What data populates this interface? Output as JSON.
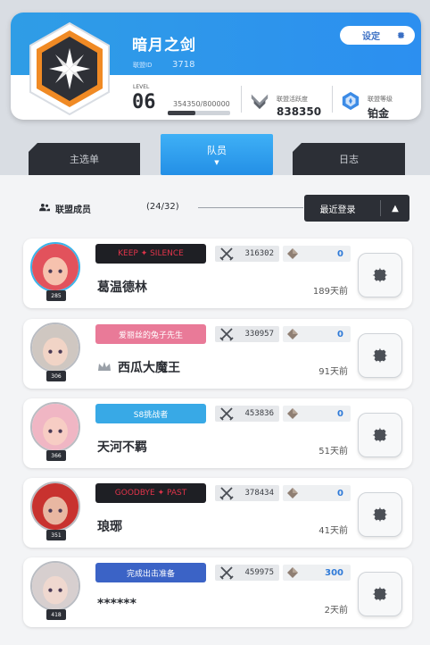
{
  "header": {
    "alliance_name": "暗月之剑",
    "alliance_id_label": "联盟ID",
    "alliance_id": "3718",
    "settings_label": "设定",
    "level_label": "LEVEL",
    "level": "06",
    "exp_text": "354350/800000",
    "exp_progress": 0.443,
    "activity_label": "联盟活跃度",
    "activity_value": "838350",
    "rank_label": "联盟等级",
    "rank_value": "铂金"
  },
  "tabs": [
    {
      "label": "主选单"
    },
    {
      "label": "队员",
      "caret": "▼"
    },
    {
      "label": "日志"
    }
  ],
  "members_header": {
    "label": "联盟成员",
    "count": "(24/32)",
    "sort_label": "最近登录",
    "sort_arrow": "▲"
  },
  "members": [
    {
      "name": "葛温德林",
      "level": "285",
      "banner": "KEEP ✦ SILENCE",
      "power": "316302",
      "contribution": "0",
      "last_login": "189天前",
      "banner_color": "#1e1f24",
      "accent": "#e0344a"
    },
    {
      "name": "西瓜大魔王",
      "level": "306",
      "banner": "爱丽丝的兔子先生",
      "power": "330957",
      "contribution": "0",
      "last_login": "91天前",
      "banner_color": "#e97a98",
      "accent": "#ffffff"
    },
    {
      "name": "天河不羁",
      "level": "366",
      "banner": "S8挑战者",
      "power": "453836",
      "contribution": "0",
      "last_login": "51天前",
      "banner_color": "#38a9e6",
      "accent": "#ffffff"
    },
    {
      "name": "琅琊",
      "level": "351",
      "banner": "GOODBYE ✦ PAST",
      "power": "378434",
      "contribution": "0",
      "last_login": "41天前",
      "banner_color": "#1e1f24",
      "accent": "#e0344a"
    },
    {
      "name": "******",
      "level": "418",
      "banner": "完成出击准备",
      "power": "459975",
      "contribution": "300",
      "last_login": "2天前",
      "banner_color": "#3b63c6",
      "accent": "#ffffff"
    }
  ],
  "colors": {
    "header_blue": "#2c8ff0",
    "dark_tab": "#2c2f36",
    "contribution_blue": "#2f7ad8",
    "emblem_orange": "#f08a24"
  }
}
